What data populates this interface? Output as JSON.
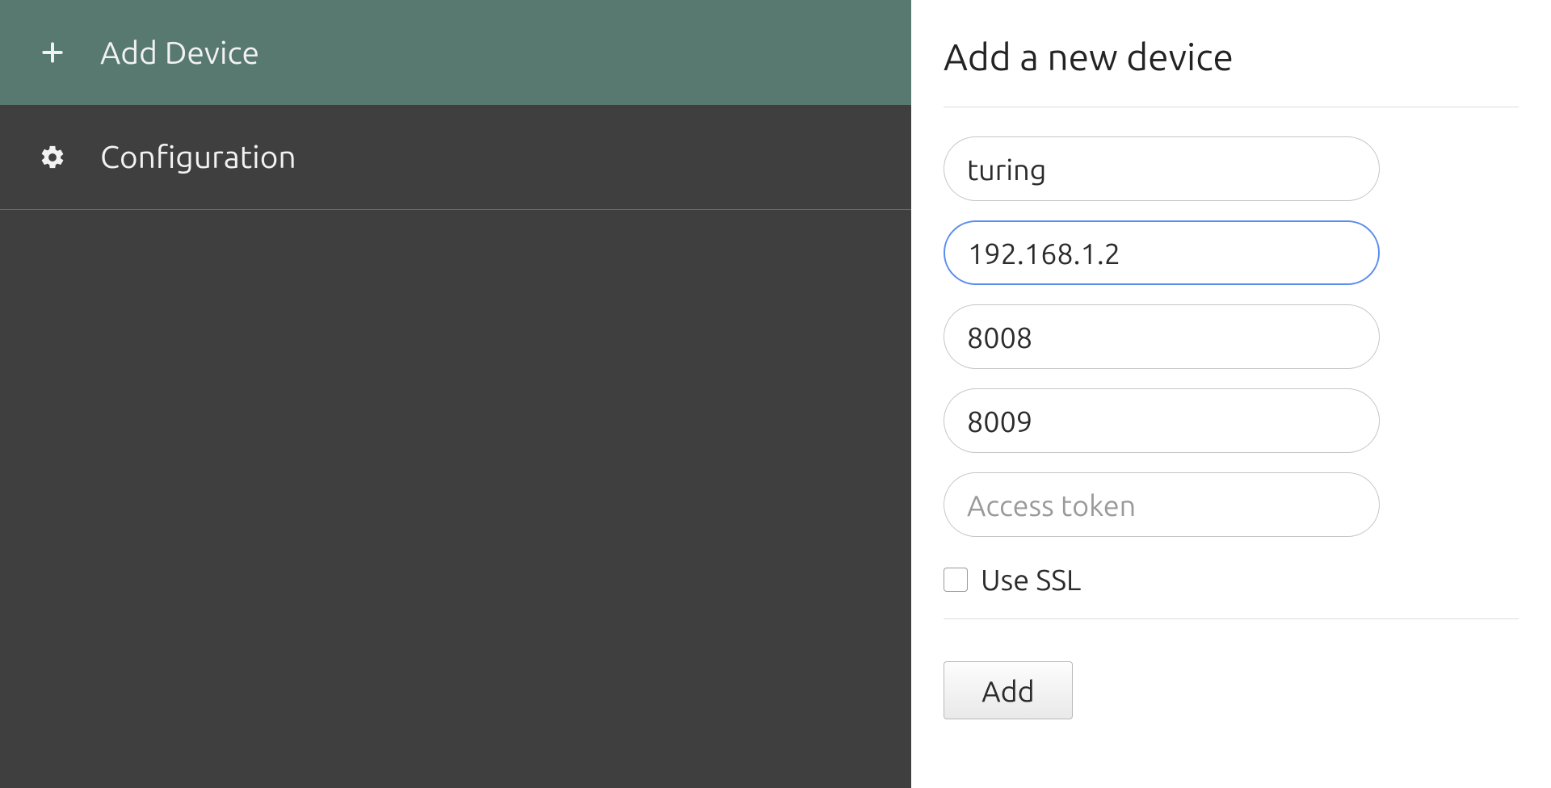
{
  "sidebar": {
    "items": [
      {
        "id": "add-device",
        "label": "Add Device",
        "icon": "plus-icon",
        "active": true
      },
      {
        "id": "configuration",
        "label": "Configuration",
        "icon": "gear-icon",
        "active": false
      }
    ]
  },
  "main": {
    "title": "Add a new device",
    "form": {
      "name": {
        "value": "turing",
        "placeholder": ""
      },
      "host": {
        "value": "192.168.1.2",
        "placeholder": "",
        "focused": true
      },
      "port1": {
        "value": "8008",
        "placeholder": ""
      },
      "port2": {
        "value": "8009",
        "placeholder": ""
      },
      "token": {
        "value": "",
        "placeholder": "Access token"
      },
      "ssl": {
        "checked": false,
        "label": "Use SSL"
      },
      "submit_label": "Add"
    }
  }
}
